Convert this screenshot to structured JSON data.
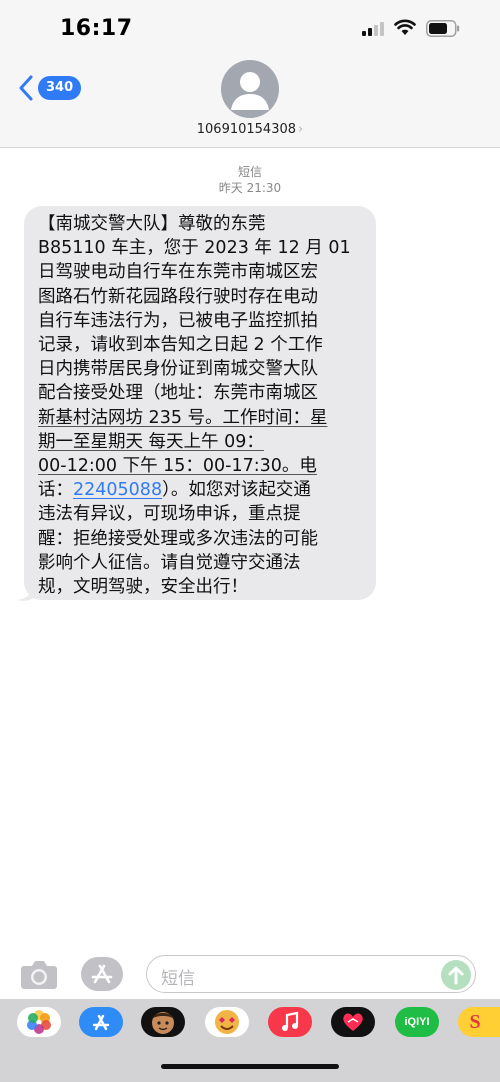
{
  "status_bar": {
    "time": "16:17"
  },
  "header": {
    "back_count": "340",
    "contact_number": "106910154308"
  },
  "conversation": {
    "service": "短信",
    "timestamp": "昨天 21:30",
    "message": {
      "lines": [
        "【南城交警大队】尊敬的东莞",
        "B85110 车主，您于 2023 年 12 月 01",
        "日驾驶电动自行车在东莞市南城区宏",
        "图路石竹新花园路段行驶时存在电动",
        "自行车违法行为，已被电子监控抓拍",
        "记录，请收到本告知之日起 2 个工作",
        "日内携带居民身份证到南城交警大队",
        "配合接受处理（地址：东莞市南城区",
        "新基村沽网坊 235 号。工作时间：星",
        "期一至星期天 每天上午 09：",
        "00-12:00 下午 15：00-17:30。电",
        "话：",
        "）。如您对该起交通",
        "违法有异议，可现场申诉，重点提",
        "醒：拒绝接受处理或多次违法的可能",
        "影响个人征信。请自觉遵守交通法",
        "规，文明驾驶，安全出行！"
      ],
      "phone_link": "22405088"
    }
  },
  "input_bar": {
    "placeholder": "短信"
  },
  "app_drawer": {
    "apps": [
      {
        "icon": "photos-icon"
      },
      {
        "icon": "app-store-icon"
      },
      {
        "icon": "memoji-icon"
      },
      {
        "icon": "animoji-icon"
      },
      {
        "icon": "music-icon"
      },
      {
        "icon": "heart-app-icon"
      },
      {
        "icon": "iqiyi-icon",
        "label": "iQIYI"
      },
      {
        "icon": "sohu-icon",
        "label": "S"
      }
    ]
  },
  "colors": {
    "accent_blue": "#2f7bf5",
    "bubble_gray": "#e9e9eb",
    "header_bg": "#f6f6f6",
    "send_green": "#b5e0bf"
  }
}
